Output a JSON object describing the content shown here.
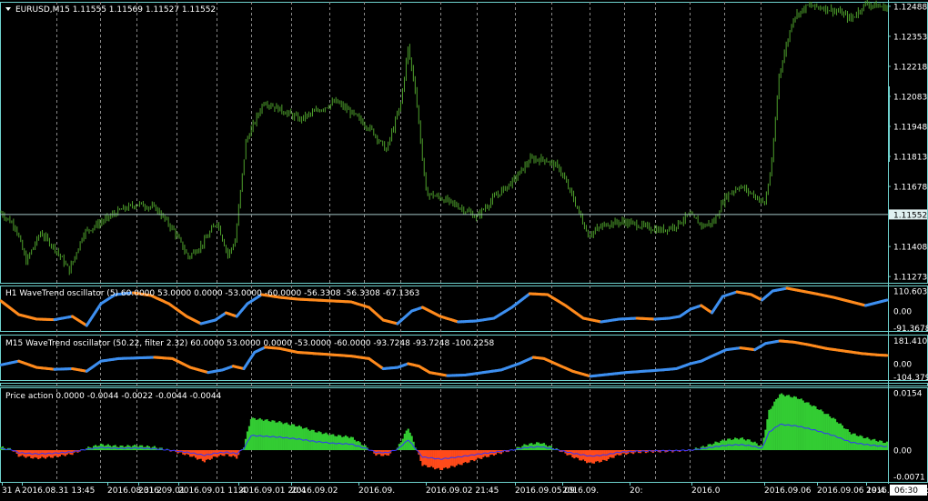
{
  "colors": {
    "background": "#000000",
    "frame": "#6fd3cf",
    "grid": "#8a8a8a",
    "candle": "#4ea02c",
    "osc_up": "#3d8ff0",
    "osc_down": "#ff8a1c",
    "area_pos": "#33cc33",
    "area_neg": "#ff4a1a",
    "price_line": "#3333ff",
    "text": "#ffffff",
    "price_tag": "#e0f0f0"
  },
  "main": {
    "symbol_label": "EURUSD,M15  1.11555 1.11569 1.11527 1.11552",
    "current_price": "1.11552",
    "price_levels": [
      "1.12488",
      "1.12353",
      "1.12218",
      "1.12083",
      "1.11948",
      "1.11813",
      "1.11678",
      "1.11543",
      "1.11408",
      "1.11273"
    ],
    "price_values": [
      1.12488,
      1.12353,
      1.12218,
      1.12083,
      1.11948,
      1.11813,
      1.11678,
      1.11543,
      1.11408,
      1.11273
    ],
    "current_value": 1.11552,
    "ylim": [
      1.11245,
      1.12508
    ]
  },
  "osc1": {
    "title": "H1 WaveTrend oscillator (5) 60.0000 53.0000 0.0000 -53.0000 -60.0000 -56.3308 -56.3308 -67.1363",
    "levels": [
      "110.6031",
      "0.00",
      "-91.3678"
    ],
    "level_values": [
      110.6031,
      0,
      -91.3678
    ]
  },
  "osc2": {
    "title": "M15 WaveTrend oscillator (50.22, filter 2.32) 60.0000 53.0000 0.0000 -53.0000 -60.0000 -93.7248 -93.7248 -100.2258",
    "levels": [
      "181.4106",
      "0.00",
      "-104.3793"
    ],
    "level_values": [
      181.4106,
      0,
      -104.3793
    ]
  },
  "osc3": {
    "title": "Price action 0.0000 -0.0044 -0.0022 -0.0044 -0.0044",
    "levels": [
      "0.0154",
      "0.00",
      "-0.0071"
    ],
    "level_values": [
      0.0154,
      0,
      -0.0071
    ]
  },
  "time_axis": {
    "ticks": [
      "31 A",
      "2016.08.31 13:45",
      "2016.08.31 2",
      "2016.09.01",
      "2016.09.01 11:4",
      "2016.09.01 20:4",
      "2016.09.02",
      "2016.09.",
      "2016.09.02 21:45",
      "2016.09.05 09",
      "2016.09.",
      "20:",
      "2016.0",
      "2016.09.06",
      "2016.09.06 19:4",
      "2016.09.07 04:45"
    ],
    "last_label": "06:30"
  },
  "chart_data": [
    {
      "type": "candlestick",
      "title": "EURUSD,M15  1.11555 1.11569 1.11527 1.11552",
      "y_tick_labels": [
        "1.12488",
        "1.12353",
        "1.12218",
        "1.12083",
        "1.11948",
        "1.11813",
        "1.11678",
        "1.11543",
        "1.11408",
        "1.11273"
      ],
      "ylim": [
        1.11245,
        1.12508
      ],
      "close_anchors": [
        [
          0,
          1.1156
        ],
        [
          8,
          1.115
        ],
        [
          14,
          1.1134
        ],
        [
          22,
          1.1147
        ],
        [
          30,
          1.114
        ],
        [
          38,
          1.113
        ],
        [
          46,
          1.1147
        ],
        [
          56,
          1.1152
        ],
        [
          66,
          1.1157
        ],
        [
          76,
          1.116
        ],
        [
          86,
          1.1158
        ],
        [
          96,
          1.1148
        ],
        [
          104,
          1.1136
        ],
        [
          112,
          1.1142
        ],
        [
          120,
          1.1152
        ],
        [
          126,
          1.1137
        ],
        [
          130,
          1.1143
        ],
        [
          136,
          1.1188
        ],
        [
          146,
          1.1206
        ],
        [
          156,
          1.1202
        ],
        [
          166,
          1.1198
        ],
        [
          176,
          1.1202
        ],
        [
          186,
          1.1206
        ],
        [
          196,
          1.12
        ],
        [
          206,
          1.1193
        ],
        [
          214,
          1.1184
        ],
        [
          222,
          1.1205
        ],
        [
          226,
          1.123
        ],
        [
          230,
          1.1212
        ],
        [
          236,
          1.1165
        ],
        [
          246,
          1.1162
        ],
        [
          256,
          1.1158
        ],
        [
          264,
          1.1154
        ],
        [
          274,
          1.1163
        ],
        [
          284,
          1.117
        ],
        [
          294,
          1.118
        ],
        [
          302,
          1.118
        ],
        [
          310,
          1.1176
        ],
        [
          318,
          1.1162
        ],
        [
          326,
          1.1146
        ],
        [
          336,
          1.1151
        ],
        [
          346,
          1.1152
        ],
        [
          356,
          1.115
        ],
        [
          366,
          1.1148
        ],
        [
          374,
          1.115
        ],
        [
          382,
          1.1155
        ],
        [
          390,
          1.115
        ],
        [
          396,
          1.1152
        ],
        [
          402,
          1.1163
        ],
        [
          410,
          1.1168
        ],
        [
          418,
          1.1164
        ],
        [
          424,
          1.116
        ],
        [
          428,
          1.1178
        ],
        [
          432,
          1.1218
        ],
        [
          440,
          1.1244
        ],
        [
          448,
          1.1249
        ],
        [
          458,
          1.1248
        ],
        [
          466,
          1.1246
        ],
        [
          472,
          1.1243
        ],
        [
          480,
          1.125
        ],
        [
          486,
          1.1249
        ],
        [
          492,
          1.1248
        ]
      ],
      "n_bars": 493
    },
    {
      "type": "line",
      "title": "H1 WaveTrend oscillator (5) 60.0000 53.0000 0.0000 -53.0000 -60.0000 -56.3308 -56.3308 -67.1363",
      "y_tick_labels": [
        "110.6031",
        "0.00",
        "-91.3678"
      ],
      "ylim": [
        -110,
        140
      ],
      "points": [
        [
          0,
          55
        ],
        [
          10,
          -20
        ],
        [
          20,
          -45
        ],
        [
          30,
          -48
        ],
        [
          40,
          -30
        ],
        [
          48,
          -80
        ],
        [
          56,
          40
        ],
        [
          64,
          90
        ],
        [
          74,
          100
        ],
        [
          84,
          85
        ],
        [
          94,
          40
        ],
        [
          104,
          -30
        ],
        [
          112,
          -70
        ],
        [
          120,
          -50
        ],
        [
          126,
          -10
        ],
        [
          132,
          -30
        ],
        [
          138,
          40
        ],
        [
          146,
          90
        ],
        [
          156,
          75
        ],
        [
          166,
          65
        ],
        [
          176,
          60
        ],
        [
          186,
          55
        ],
        [
          196,
          50
        ],
        [
          206,
          20
        ],
        [
          214,
          -50
        ],
        [
          222,
          -70
        ],
        [
          230,
          0
        ],
        [
          236,
          20
        ],
        [
          246,
          -30
        ],
        [
          256,
          -60
        ],
        [
          266,
          -55
        ],
        [
          276,
          -40
        ],
        [
          286,
          20
        ],
        [
          296,
          95
        ],
        [
          306,
          90
        ],
        [
          316,
          30
        ],
        [
          326,
          -40
        ],
        [
          336,
          -60
        ],
        [
          346,
          -45
        ],
        [
          356,
          -40
        ],
        [
          366,
          -45
        ],
        [
          374,
          -40
        ],
        [
          380,
          -30
        ],
        [
          386,
          10
        ],
        [
          392,
          30
        ],
        [
          398,
          -10
        ],
        [
          404,
          80
        ],
        [
          412,
          105
        ],
        [
          420,
          90
        ],
        [
          426,
          60
        ],
        [
          432,
          110
        ],
        [
          440,
          125
        ],
        [
          448,
          110
        ],
        [
          456,
          95
        ],
        [
          466,
          75
        ],
        [
          476,
          50
        ],
        [
          484,
          30
        ],
        [
          490,
          45
        ],
        [
          496,
          60
        ]
      ],
      "color_rule": "blue when rising, orange when falling"
    },
    {
      "type": "line",
      "title": "M15 WaveTrend oscillator (50.22, filter 2.32) 60.0000 53.0000 0.0000 -53.0000 -60.0000 -93.7248 -93.7248 -100.2258",
      "y_tick_labels": [
        "181.4106",
        "0.00",
        "-104.3793"
      ],
      "ylim": [
        -130,
        230
      ],
      "points": [
        [
          0,
          -10
        ],
        [
          10,
          20
        ],
        [
          20,
          -30
        ],
        [
          30,
          -45
        ],
        [
          40,
          -40
        ],
        [
          48,
          -60
        ],
        [
          56,
          20
        ],
        [
          66,
          40
        ],
        [
          76,
          45
        ],
        [
          86,
          50
        ],
        [
          96,
          40
        ],
        [
          106,
          -30
        ],
        [
          116,
          -70
        ],
        [
          124,
          -50
        ],
        [
          130,
          -20
        ],
        [
          136,
          -40
        ],
        [
          142,
          90
        ],
        [
          148,
          130
        ],
        [
          156,
          120
        ],
        [
          166,
          90
        ],
        [
          176,
          80
        ],
        [
          186,
          70
        ],
        [
          196,
          60
        ],
        [
          206,
          40
        ],
        [
          214,
          -40
        ],
        [
          222,
          -30
        ],
        [
          228,
          0
        ],
        [
          234,
          -20
        ],
        [
          240,
          -70
        ],
        [
          250,
          -95
        ],
        [
          260,
          -90
        ],
        [
          270,
          -70
        ],
        [
          280,
          -50
        ],
        [
          290,
          0
        ],
        [
          298,
          50
        ],
        [
          304,
          40
        ],
        [
          312,
          -10
        ],
        [
          320,
          -60
        ],
        [
          330,
          -100
        ],
        [
          340,
          -85
        ],
        [
          350,
          -70
        ],
        [
          360,
          -60
        ],
        [
          370,
          -50
        ],
        [
          378,
          -40
        ],
        [
          386,
          0
        ],
        [
          392,
          20
        ],
        [
          398,
          60
        ],
        [
          406,
          110
        ],
        [
          414,
          125
        ],
        [
          422,
          110
        ],
        [
          428,
          160
        ],
        [
          436,
          180
        ],
        [
          444,
          170
        ],
        [
          452,
          150
        ],
        [
          462,
          120
        ],
        [
          472,
          100
        ],
        [
          482,
          80
        ],
        [
          490,
          70
        ],
        [
          496,
          65
        ]
      ],
      "color_rule": "blue when rising, orange when falling"
    },
    {
      "type": "area",
      "title": "Price action 0.0000 -0.0044 -0.0022 -0.0044 -0.0044",
      "y_tick_labels": [
        "0.0154",
        "0.00",
        "-0.0071"
      ],
      "ylim": [
        -0.0085,
        0.0168
      ],
      "area_points": [
        [
          0,
          0.0008
        ],
        [
          6,
          0.0002
        ],
        [
          10,
          -0.0015
        ],
        [
          20,
          -0.0022
        ],
        [
          30,
          -0.0018
        ],
        [
          40,
          -0.001
        ],
        [
          48,
          0.0005
        ],
        [
          56,
          0.0015
        ],
        [
          66,
          0.001
        ],
        [
          76,
          0.0012
        ],
        [
          86,
          0.0008
        ],
        [
          96,
          -0.0002
        ],
        [
          106,
          -0.0015
        ],
        [
          114,
          -0.003
        ],
        [
          120,
          -0.0018
        ],
        [
          126,
          -0.0012
        ],
        [
          132,
          -0.002
        ],
        [
          136,
          0.001
        ],
        [
          140,
          0.0085
        ],
        [
          146,
          0.0082
        ],
        [
          156,
          0.0075
        ],
        [
          166,
          0.0065
        ],
        [
          176,
          0.005
        ],
        [
          186,
          0.004
        ],
        [
          196,
          0.0035
        ],
        [
          204,
          0.001
        ],
        [
          210,
          -0.0012
        ],
        [
          216,
          -0.0015
        ],
        [
          222,
          0.0005
        ],
        [
          228,
          0.006
        ],
        [
          232,
          0.001
        ],
        [
          236,
          -0.004
        ],
        [
          246,
          -0.0052
        ],
        [
          256,
          -0.004
        ],
        [
          266,
          -0.0025
        ],
        [
          276,
          -0.0012
        ],
        [
          286,
          0.0
        ],
        [
          294,
          0.0015
        ],
        [
          302,
          0.002
        ],
        [
          310,
          0.0005
        ],
        [
          320,
          -0.0018
        ],
        [
          330,
          -0.0035
        ],
        [
          338,
          -0.0028
        ],
        [
          346,
          -0.0012
        ],
        [
          356,
          -0.0006
        ],
        [
          366,
          -0.0004
        ],
        [
          376,
          -0.0003
        ],
        [
          386,
          0.0
        ],
        [
          394,
          0.001
        ],
        [
          400,
          0.002
        ],
        [
          406,
          0.0028
        ],
        [
          414,
          0.0032
        ],
        [
          420,
          0.0025
        ],
        [
          426,
          0.001
        ],
        [
          430,
          0.0105
        ],
        [
          436,
          0.015
        ],
        [
          446,
          0.014
        ],
        [
          456,
          0.0115
        ],
        [
          466,
          0.0085
        ],
        [
          476,
          0.0045
        ],
        [
          486,
          0.003
        ],
        [
          496,
          0.002
        ]
      ],
      "line_ratio": 0.46
    }
  ]
}
